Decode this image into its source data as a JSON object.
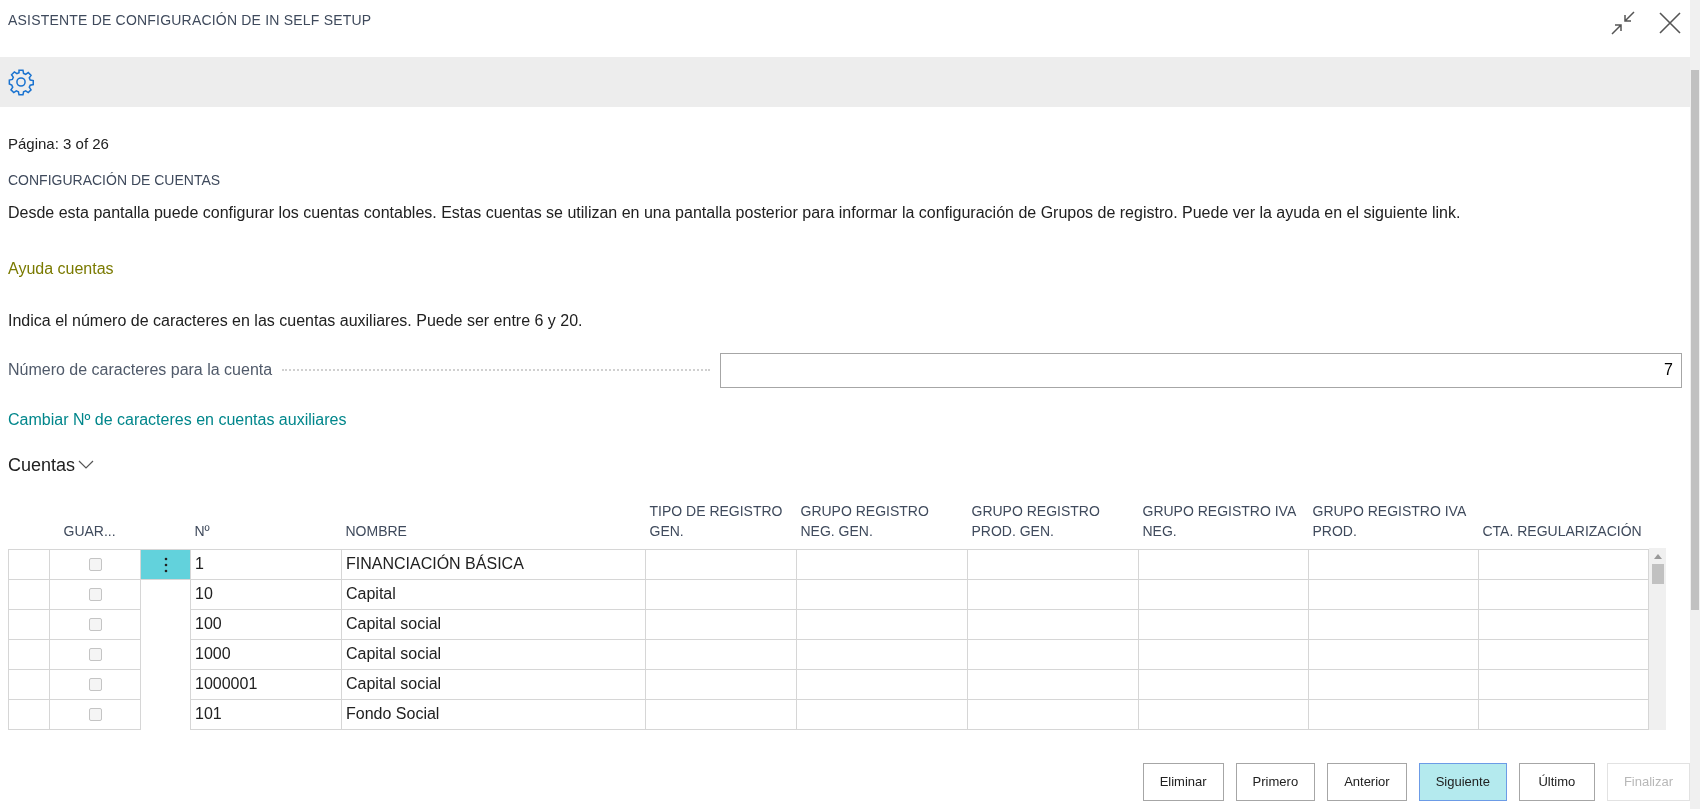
{
  "window": {
    "title": "ASISTENTE DE CONFIGURACIÓN DE IN SELF SETUP"
  },
  "page_indicator": "Página: 3 of 26",
  "section_title": "CONFIGURACIÓN DE CUENTAS",
  "description": "Desde esta pantalla puede configurar los cuentas contables. Estas cuentas se utilizan en una pantalla posterior para informar la configuración de Grupos de registro. Puede ver la ayuda en el siguiente link.",
  "help_link": "Ayuda cuentas",
  "instruction": "Indica el número de caracteres en las cuentas auxiliares. Puede ser entre 6 y 20.",
  "field": {
    "label": "Número de caracteres para la cuenta",
    "value": "7"
  },
  "action_link": "Cambiar Nº de caracteres en cuentas auxiliares",
  "group": {
    "title": "Cuentas",
    "expanded": true
  },
  "table": {
    "columns": [
      "GUAR...",
      "Nº",
      "NOMBRE",
      "TIPO DE REGISTRO GEN.",
      "GRUPO REGISTRO NEG. GEN.",
      "GRUPO REGISTRO PROD. GEN.",
      "GRUPO REGISTRO IVA NEG.",
      "GRUPO REGISTRO IVA PROD.",
      "CTA. REGULARIZACIÓN"
    ],
    "rows": [
      {
        "checked": false,
        "selected": true,
        "no": "1",
        "name": "FINANCIACIÓN BÁSICA"
      },
      {
        "checked": false,
        "selected": false,
        "no": "10",
        "name": "Capital"
      },
      {
        "checked": false,
        "selected": false,
        "no": "100",
        "name": "Capital social"
      },
      {
        "checked": false,
        "selected": false,
        "no": "1000",
        "name": "Capital social"
      },
      {
        "checked": false,
        "selected": false,
        "no": "1000001",
        "name": "Capital social"
      },
      {
        "checked": false,
        "selected": false,
        "no": "101",
        "name": "Fondo Social"
      }
    ]
  },
  "buttons": [
    {
      "label": "Eliminar",
      "primary": false,
      "disabled": false
    },
    {
      "label": "Primero",
      "primary": false,
      "disabled": false
    },
    {
      "label": "Anterior",
      "primary": false,
      "disabled": false
    },
    {
      "label": "Siguiente",
      "primary": true,
      "disabled": false
    },
    {
      "label": "Último",
      "primary": false,
      "disabled": false
    },
    {
      "label": "Finalizar",
      "primary": false,
      "disabled": true
    }
  ]
}
